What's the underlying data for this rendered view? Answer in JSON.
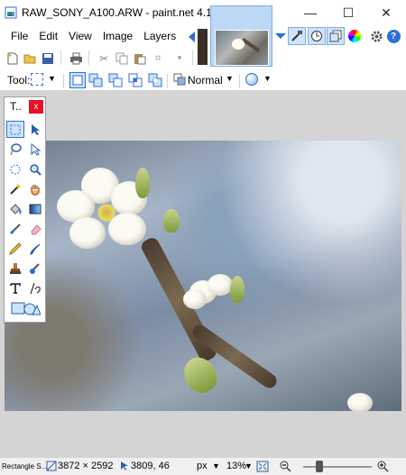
{
  "window": {
    "title": "RAW_SONY_A100.ARW - paint.net 4.1",
    "minimize": "—",
    "maximize": "☐",
    "close": "✕"
  },
  "menu": {
    "items": [
      "File",
      "Edit",
      "View",
      "Image",
      "Layers"
    ]
  },
  "toolbar2": {
    "tool_label": "Tool:",
    "blend_mode": "Normal"
  },
  "tools_panel": {
    "title": "T..",
    "close": "x"
  },
  "status": {
    "tool_hint": "Rectangle S...",
    "image_size": "3872 × 2592",
    "cursor_position": "3809, 46",
    "units": "px",
    "zoom": "13%"
  },
  "colors": {
    "accent": "#2b6fd8",
    "close_red": "#e81123",
    "canvas_bg": "#d4d4d4"
  }
}
